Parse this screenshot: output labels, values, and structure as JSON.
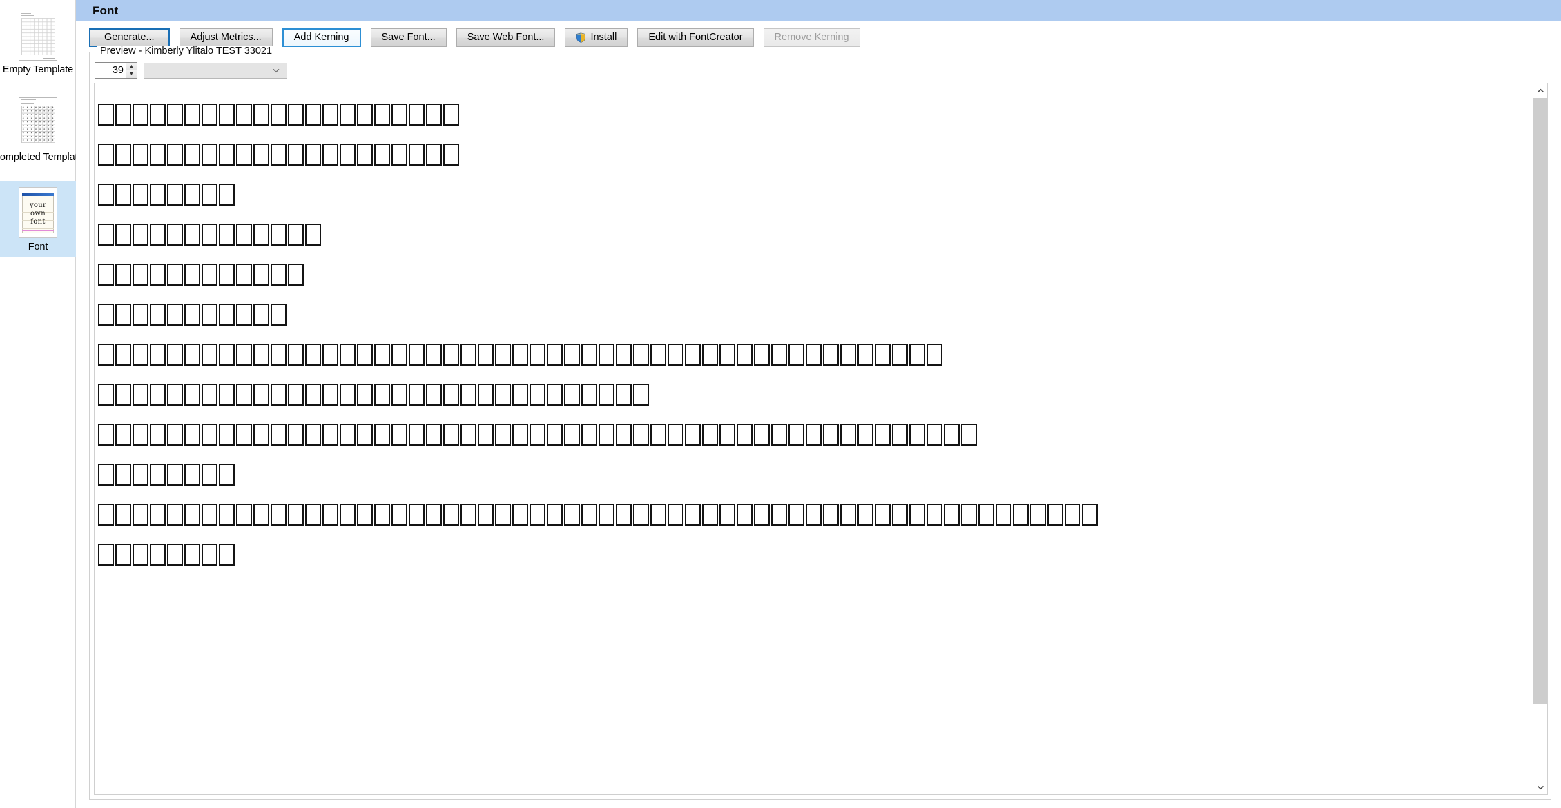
{
  "sidebar": {
    "items": [
      {
        "label": "Empty Template",
        "thumb": "empty-template-sheet",
        "selected": false
      },
      {
        "label": "Completed Template",
        "thumb": "completed-template-sheet",
        "selected": false
      },
      {
        "label": "Font",
        "thumb": "handwriting-font-sample",
        "selected": true
      }
    ],
    "font_thumb_lines": [
      "your",
      "own",
      "font"
    ]
  },
  "header": {
    "title": "Font"
  },
  "toolbar": {
    "buttons": [
      {
        "label": "Generate...",
        "state": "default",
        "icon": ""
      },
      {
        "label": "Adjust Metrics...",
        "state": "normal",
        "icon": ""
      },
      {
        "label": "Add Kerning",
        "state": "focus",
        "icon": ""
      },
      {
        "label": "Save Font...",
        "state": "normal",
        "icon": ""
      },
      {
        "label": "Save Web Font...",
        "state": "normal",
        "icon": ""
      },
      {
        "label": "Install",
        "state": "normal",
        "icon": "uac-shield-icon"
      },
      {
        "label": "Edit with FontCreator",
        "state": "normal",
        "icon": ""
      },
      {
        "label": "Remove Kerning",
        "state": "disabled",
        "icon": ""
      }
    ]
  },
  "preview_group": {
    "legend": "Preview - Kimberly Ylitalo TEST 33021",
    "size_value": "39",
    "size_placeholder": "",
    "sample_text_value": "",
    "sample_text_placeholder": "",
    "spinner_up_icon": "spinner-up-arrow-icon",
    "spinner_down_icon": "spinner-down-arrow-icon",
    "combo_chevron_icon": "chevron-down-icon"
  },
  "preview_canvas": {
    "note": "Each row renders missing-glyph tofu boxes; counts read off the screenshot.",
    "rows": [
      {
        "boxes": 21
      },
      {
        "boxes": 21
      },
      {
        "boxes": 8
      },
      {
        "boxes": 13
      },
      {
        "boxes": 12
      },
      {
        "boxes": 11
      },
      {
        "boxes": 49
      },
      {
        "boxes": 32
      },
      {
        "boxes": 51
      },
      {
        "boxes": 8
      },
      {
        "boxes": 58
      },
      {
        "boxes": 8
      }
    ]
  },
  "scrollbar": {
    "up_icon": "scroll-up-arrow-icon",
    "down_icon": "scroll-down-arrow-icon",
    "thumb_name": "scroll-thumb"
  },
  "colors": {
    "header_bg": "#aecbf0",
    "selection_bg": "#cce4f7",
    "default_button_border": "#1a6fb5",
    "focus_button_border": "#2d8fd4",
    "scroll_thumb": "#cdcdcd"
  }
}
